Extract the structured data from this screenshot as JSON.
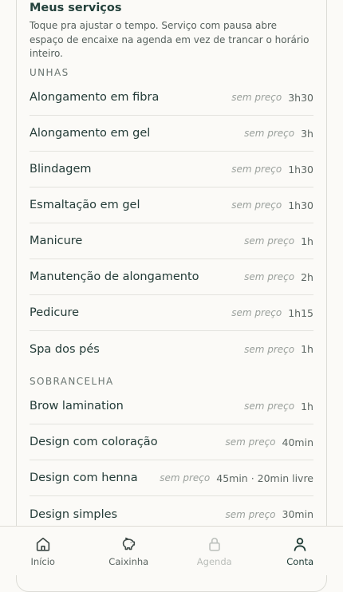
{
  "header": {
    "title": "Meus serviços",
    "subtitle": "Toque pra ajustar o tempo. Serviço com pausa abre espaço de encaixe na agenda em vez de trancar o horário inteiro."
  },
  "sections": [
    {
      "name": "UNHAS",
      "services": [
        {
          "name": "Alongamento em fibra",
          "price": "sem preço",
          "duration": "3h30"
        },
        {
          "name": "Alongamento em gel",
          "price": "sem preço",
          "duration": "3h"
        },
        {
          "name": "Blindagem",
          "price": "sem preço",
          "duration": "1h30"
        },
        {
          "name": "Esmaltação em gel",
          "price": "sem preço",
          "duration": "1h30"
        },
        {
          "name": "Manicure",
          "price": "sem preço",
          "duration": "1h"
        },
        {
          "name": "Manutenção de alongamento",
          "price": "sem preço",
          "duration": "2h"
        },
        {
          "name": "Pedicure",
          "price": "sem preço",
          "duration": "1h15"
        },
        {
          "name": "Spa dos pés",
          "price": "sem preço",
          "duration": "1h"
        }
      ]
    },
    {
      "name": "SOBRANCELHA",
      "services": [
        {
          "name": "Brow lamination",
          "price": "sem preço",
          "duration": "1h"
        },
        {
          "name": "Design com coloração",
          "price": "sem preço",
          "duration": "40min"
        },
        {
          "name": "Design com henna",
          "price": "sem preço",
          "duration": "45min · 20min livre"
        },
        {
          "name": "Design simples",
          "price": "sem preço",
          "duration": "30min"
        }
      ]
    }
  ],
  "tabbar": {
    "items": [
      {
        "label": "Início",
        "icon": "home-icon",
        "state": "normal"
      },
      {
        "label": "Caixinha",
        "icon": "piggy-bank-icon",
        "state": "normal"
      },
      {
        "label": "Agenda",
        "icon": "lock-icon",
        "state": "disabled"
      },
      {
        "label": "Conta",
        "icon": "user-icon",
        "state": "active"
      }
    ]
  },
  "colors": {
    "background": "#fbfaf7",
    "text_primary": "#233b37",
    "text_muted": "#9aa09c",
    "active_tab": "#1f3c36",
    "disabled_tab": "#b9bdb9"
  }
}
